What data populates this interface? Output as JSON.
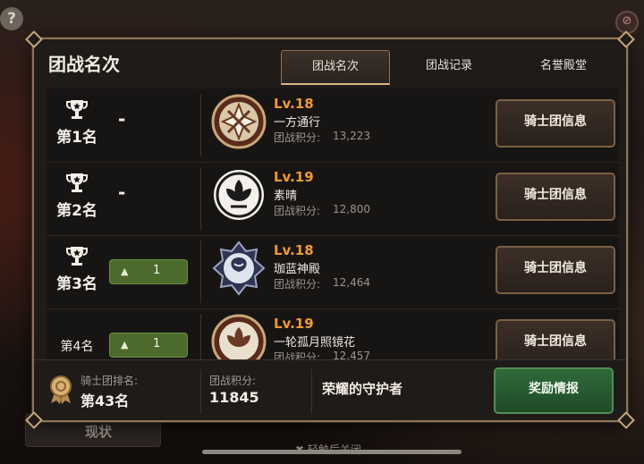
{
  "background": {
    "help_glyph": "?",
    "close_glyph": "⊘",
    "status_button_label": "现状",
    "hint": "✖ 轻触后关闭"
  },
  "panel": {
    "title": "团战名次",
    "tabs": [
      {
        "label": "团战名次",
        "active": true
      },
      {
        "label": "团战记录",
        "active": false
      },
      {
        "label": "名誉殿堂",
        "active": false
      }
    ]
  },
  "rows": [
    {
      "rank": "第1名",
      "change": "-",
      "change_type": "dash",
      "level": "Lv.18",
      "name": "一方通行",
      "score_label": "团战积分:",
      "score": "13,223",
      "button": "骑士团信息",
      "emblem": "cross-emblem-icon"
    },
    {
      "rank": "第2名",
      "change": "-",
      "change_type": "dash",
      "level": "Lv.19",
      "name": "素晴",
      "score_label": "团战积分:",
      "score": "12,800",
      "button": "骑士团信息",
      "emblem": "lotus-emblem-icon"
    },
    {
      "rank": "第3名",
      "change": "1",
      "change_type": "up",
      "level": "Lv.18",
      "name": "珈蓝神殿",
      "score_label": "团战积分:",
      "score": "12,464",
      "button": "骑士团信息",
      "emblem": "rose-emblem-icon"
    },
    {
      "rank": "第4名",
      "change": "1",
      "change_type": "up",
      "level": "Lv.19",
      "name": "一轮孤月照镜花",
      "score_label": "团战积分:",
      "score": "12,457",
      "button": "骑士团信息",
      "emblem": "lotus-emblem-icon"
    }
  ],
  "footer": {
    "rank_label": "骑士团排名:",
    "rank_value": "第43名",
    "score_label": "团战积分:",
    "score_value": "11845",
    "title": "荣耀的守护者",
    "reward_button": "奖励情报"
  },
  "colors": {
    "level": "#f39a2a",
    "gold_border": "#8b7458",
    "reward_green": "#2f6a3a",
    "badge_green": "#4c6a2c"
  }
}
